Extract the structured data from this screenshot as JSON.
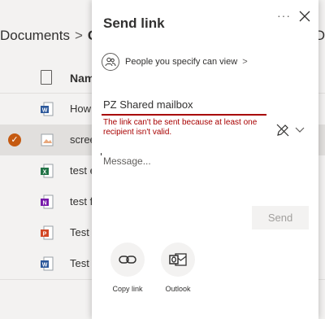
{
  "breadcrumb": {
    "parent": "Documents",
    "separator": ">",
    "current": "G"
  },
  "list": {
    "name_header": "Nam",
    "right_label": "D",
    "rows": [
      {
        "name": "How",
        "type": "word"
      },
      {
        "name": "scree",
        "type": "image"
      },
      {
        "name": "test e",
        "type": "excel"
      },
      {
        "name": "test f",
        "type": "onenote"
      },
      {
        "name": "Test p",
        "type": "powerpoint"
      },
      {
        "name": "Test W",
        "type": "word"
      }
    ]
  },
  "dialog": {
    "title": "Send link",
    "more": "···",
    "permission": "People you specify can view",
    "permission_chevron": ">",
    "recipient": "PZ Shared mailbox",
    "error": "The link can't be sent because at least one recipient isn't valid.",
    "message_placeholder": "Message...",
    "send_label": "Send",
    "actions": {
      "copy_link": "Copy link",
      "outlook": "Outlook"
    }
  },
  "colors": {
    "error": "#a80000",
    "selected_check": "#c55a11"
  }
}
